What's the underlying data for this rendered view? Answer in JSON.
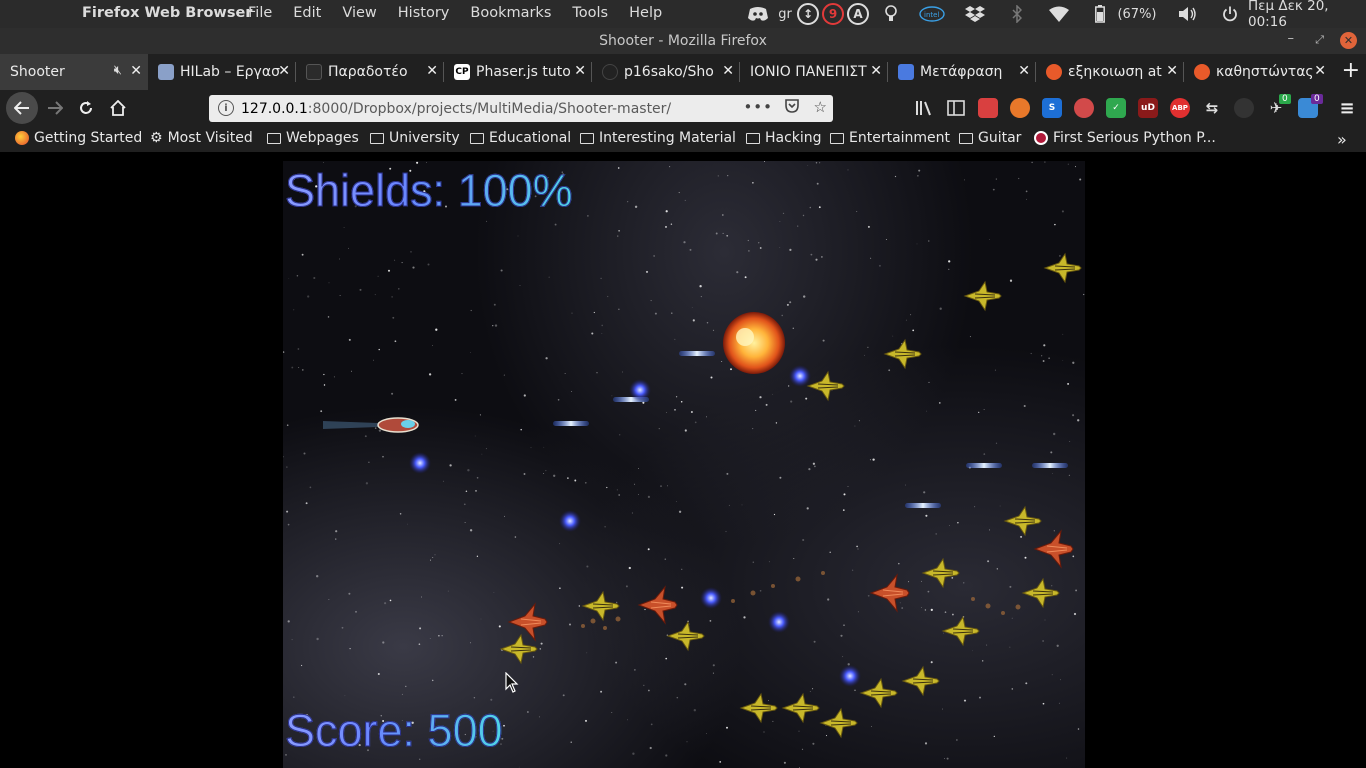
{
  "system_panel": {
    "app_name": "Firefox Web Browser",
    "menus": [
      "File",
      "Edit",
      "View",
      "History",
      "Bookmarks",
      "Tools",
      "Help"
    ],
    "keyboard_layout": "gr",
    "notif_count": "9",
    "accessibility_letter": "A",
    "battery": "(67%)",
    "datetime": "Πεμ Δεκ 20, 00:16"
  },
  "window": {
    "title": "Shooter - Mozilla Firefox"
  },
  "tabs": [
    {
      "label": "Shooter",
      "active": true,
      "favicon_color": "#3b3b3b",
      "favicon_text": ""
    },
    {
      "label": "HILab – Εργασ",
      "active": false,
      "favicon_color": "#8aa0c8",
      "favicon_text": ""
    },
    {
      "label": "Παραδοτέο",
      "active": false,
      "favicon_color": "#2b2b2b",
      "favicon_text": ""
    },
    {
      "label": "Phaser.js tuto",
      "active": false,
      "favicon_color": "#ffffff",
      "favicon_text": "CP"
    },
    {
      "label": "p16sako/Sho",
      "active": false,
      "favicon_color": "#222222",
      "favicon_text": ""
    },
    {
      "label": "ΙΟΝΙΟ ΠΑΝΕΠΙΣΤ",
      "active": false,
      "favicon_color": "#202020",
      "favicon_text": ""
    },
    {
      "label": "Μετάφραση",
      "active": false,
      "favicon_color": "#4a7ae0",
      "favicon_text": ""
    },
    {
      "label": "εξηκοιωση at",
      "active": false,
      "favicon_color": "#e85a2a",
      "favicon_text": ""
    },
    {
      "label": "καθηστώντας",
      "active": false,
      "favicon_color": "#e85a2a",
      "favicon_text": ""
    }
  ],
  "urlbar": {
    "host": "127.0.0.1",
    "rest": ":8000/Dropbox/projects/MultiMedia/Shooter-master/"
  },
  "extensions": {
    "ublock": "uD",
    "abp": "ABP",
    "badge_green": "0",
    "badge_purple": "0"
  },
  "bookmarks": [
    {
      "label": "Getting Started",
      "type": "firefox"
    },
    {
      "label": "Most Visited",
      "type": "gear"
    },
    {
      "label": "Webpages",
      "type": "folder"
    },
    {
      "label": "University",
      "type": "folder"
    },
    {
      "label": "Educational",
      "type": "folder"
    },
    {
      "label": "Interesting Material",
      "type": "folder"
    },
    {
      "label": "Hacking",
      "type": "folder"
    },
    {
      "label": "Entertainment",
      "type": "folder"
    },
    {
      "label": "Guitar",
      "type": "folder"
    },
    {
      "label": "First Serious Python P...",
      "type": "python"
    }
  ],
  "game": {
    "shields_text": "Shields: 100%",
    "score_text": "Score: 500"
  }
}
